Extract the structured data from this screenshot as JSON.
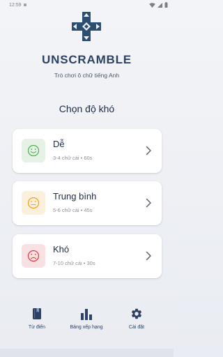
{
  "status": {
    "time": "12:59"
  },
  "app": {
    "title": "UNSCRAMBLE",
    "subtitle": "Trò chơi ô chữ tiếng Anh"
  },
  "difficulty": {
    "heading": "Chọn độ khó",
    "levels": [
      {
        "title": "Dễ",
        "desc": "3-4 chữ cái • 60s",
        "face": "happy",
        "color": "#4caf50",
        "bg": "#e6f2e6"
      },
      {
        "title": "Trung bình",
        "desc": "5-6 chữ cái • 45s",
        "face": "neutral",
        "color": "#f59e1b",
        "bg": "#fbf0dc"
      },
      {
        "title": "Khó",
        "desc": "7-10 chữ cái • 30s",
        "face": "sad",
        "color": "#e53935",
        "bg": "#f9e1e3"
      }
    ]
  },
  "nav": {
    "items": [
      {
        "label": "Từ điển",
        "icon": "book-icon"
      },
      {
        "label": "Bảng xếp hạng",
        "icon": "leaderboard-icon"
      },
      {
        "label": "Cài đặt",
        "icon": "gear-icon"
      }
    ]
  },
  "colors": {
    "accent": "#2d4163",
    "logo": "#2d4e73"
  }
}
